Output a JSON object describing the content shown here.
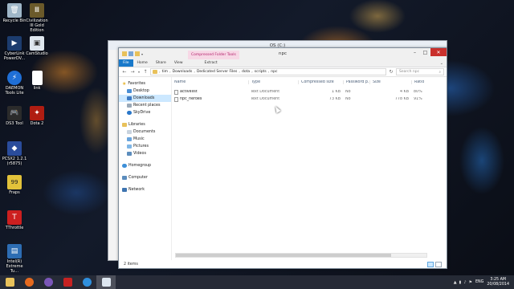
{
  "desktop": {
    "icons": [
      {
        "label": "Recycle Bin",
        "icon": "recycle-bin-icon",
        "color": "#9fb6c8"
      },
      {
        "label": "Civilization III Gold Edition",
        "icon": "civilization-icon",
        "color": "#6b5a2a"
      },
      {
        "label": "CyberLink PowerDV...",
        "icon": "cyberlink-icon",
        "color": "#1c3c6e"
      },
      {
        "label": "CamStudio",
        "icon": "camstudio-icon",
        "color": "#dfe7ef"
      },
      {
        "label": "DAEMON Tools Lite",
        "icon": "daemon-tools-icon",
        "color": "#1f6fd6"
      },
      {
        "label": "link",
        "icon": "file-icon",
        "color": "#ffffff"
      },
      {
        "label": "DS3 Tool",
        "icon": "gamepad-icon",
        "color": "#2b2b2b"
      },
      {
        "label": "Dota 2",
        "icon": "dota-icon",
        "color": "#b01d12"
      },
      {
        "label": "PCSX2 1.2.1 (r5875)",
        "icon": "pcsx2-icon",
        "color": "#2a4c9b"
      },
      {
        "label": "Fraps",
        "icon": "fraps-icon",
        "color": "#e2c23a"
      },
      {
        "label": "TThrottle",
        "icon": "tthrottle-icon",
        "color": "#cc1f1f"
      },
      {
        "label": "Intel(R) Extreme Tu...",
        "icon": "intel-icon",
        "color": "#2d6db3"
      }
    ]
  },
  "background_window": {
    "title": "OS (C:)"
  },
  "window": {
    "title": "npc",
    "contextual_tab": "Compressed Folder Tools",
    "ribbon_tabs": [
      "File",
      "Home",
      "Share",
      "View"
    ],
    "extract_tab": "Extract",
    "controls": {
      "minimize": "–",
      "maximize": "□",
      "close": "✕"
    },
    "address": {
      "segments": [
        "tim",
        "Downloads",
        "Dedicated Server Files",
        "dota",
        "scripts",
        "npc"
      ]
    },
    "search_placeholder": "Search npc",
    "nav": {
      "favorites": {
        "label": "Favorites",
        "items": [
          "Desktop",
          "Downloads",
          "Recent places",
          "SkyDrive"
        ]
      },
      "libraries": {
        "label": "Libraries",
        "items": [
          "Documents",
          "Music",
          "Pictures",
          "Videos"
        ]
      },
      "homegroup": "Homegroup",
      "computer": "Computer",
      "network": "Network"
    },
    "columns": [
      "Name",
      "Type",
      "Compressed size",
      "Password p...",
      "Size",
      "Ratio"
    ],
    "files": [
      {
        "name": "activelist",
        "type": "Text Document",
        "compressed": "1 KB",
        "password": "No",
        "size": "4 KB",
        "ratio": "80%"
      },
      {
        "name": "npc_heroes",
        "type": "Text Document",
        "compressed": "73 KB",
        "password": "No",
        "size": "778 KB",
        "ratio": "91%"
      }
    ],
    "status": "2 items"
  },
  "taskbar": {
    "apps": [
      "file-explorer-icon",
      "firefox-icon",
      "media-player-icon",
      "acrobat-icon",
      "ie-icon",
      "explorer-window-icon"
    ],
    "language": "ENG",
    "time": "3:25 AM",
    "date": "20/08/2014"
  }
}
